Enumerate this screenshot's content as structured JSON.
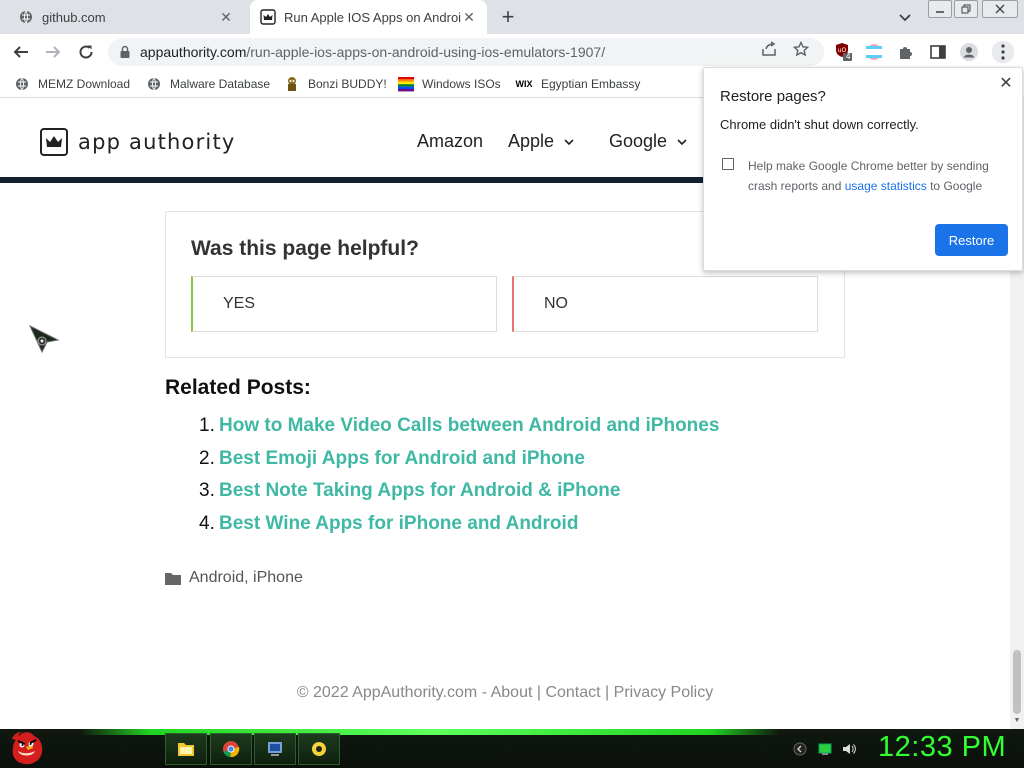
{
  "browser": {
    "tabs": [
      {
        "title": "github.com",
        "active": false
      },
      {
        "title": "Run Apple IOS Apps on Android",
        "active": true
      }
    ],
    "omnibox": {
      "host": "appauthority.com",
      "path": "/run-apple-ios-apps-on-android-using-ios-emulators-1907/"
    },
    "extension_badge": "4",
    "bookmarks": [
      {
        "label": "MEMZ Download",
        "icon": "globe-icon"
      },
      {
        "label": "Malware Database",
        "icon": "globe-icon"
      },
      {
        "label": "Bonzi BUDDY!",
        "icon": "bonzi-icon"
      },
      {
        "label": "Windows ISOs",
        "icon": "windows-icon"
      },
      {
        "label": "Egyptian Embassy",
        "icon": "wix-icon"
      }
    ],
    "wix_text": "WIX"
  },
  "site": {
    "logo_text": "app authority",
    "nav": [
      {
        "label": "Amazon",
        "dropdown": false
      },
      {
        "label": "Apple",
        "dropdown": true
      },
      {
        "label": "Google",
        "dropdown": true
      }
    ],
    "feedback": {
      "question": "Was this page helpful?",
      "yes": "YES",
      "no": "NO"
    },
    "related_title": "Related Posts:",
    "related": [
      {
        "num": "1.",
        "title": "How to Make Video Calls between Android and iPhones"
      },
      {
        "num": "2.",
        "title": "Best Emoji Apps for Android and iPhone"
      },
      {
        "num": "3.",
        "title": "Best Note Taking Apps for Android & iPhone"
      },
      {
        "num": "4.",
        "title": "Best Wine Apps for iPhone and Android"
      }
    ],
    "categories": {
      "first": "Android",
      "sep": ", ",
      "second": "iPhone"
    },
    "footer": {
      "copyright": "© 2022 AppAuthority.com - ",
      "about": "About",
      "bar": " | ",
      "contact": "Contact",
      "privacy": "Privacy Policy"
    }
  },
  "popup": {
    "title": "Restore pages?",
    "message": "Chrome didn't shut down correctly.",
    "checkbox_text": "Help make Google Chrome better by sending crash reports and ",
    "checkbox_link": "usage statistics",
    "checkbox_suffix": " to Google",
    "restore_label": "Restore"
  },
  "taskbar": {
    "clock": "12:33 PM",
    "items": [
      "folder-icon",
      "chrome-icon",
      "installer-icon",
      "media-player-icon"
    ]
  },
  "colors": {
    "link_teal": "#3fb8a4",
    "chrome_blue": "#1a73e8",
    "header_border": "#12202f",
    "clock_green": "#32ff32"
  }
}
